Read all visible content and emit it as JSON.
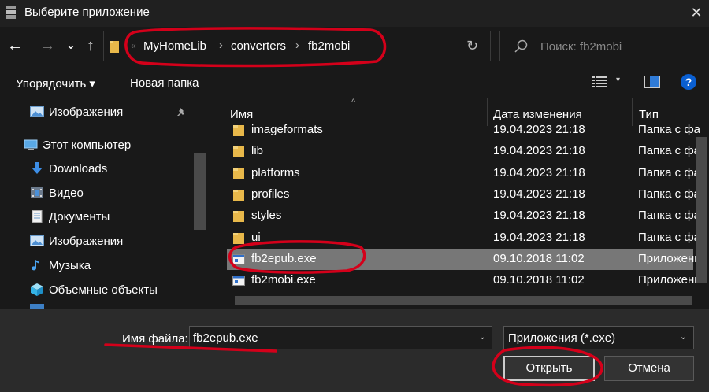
{
  "window": {
    "title": "Выберите приложение",
    "close_glyph": "✕"
  },
  "nav": {
    "back_glyph": "←",
    "forward_glyph": "→",
    "recent_glyph": "⌄",
    "up_glyph": "↑",
    "sep_glyph": "«",
    "breadcrumbs": [
      "MyHomeLib",
      "converters",
      "fb2mobi"
    ],
    "crumb_sep": "›",
    "refresh_glyph": "↻",
    "search_placeholder": "Поиск: fb2mobi"
  },
  "toolbar": {
    "organize_label": "Упорядочить ▾",
    "new_folder_label": "Новая папка",
    "views_dd_glyph": "▾",
    "help_glyph": "?"
  },
  "sidebar": {
    "items": [
      {
        "label": "Изображения",
        "icon": "pictures-icon"
      },
      {
        "label": "Этот компьютер",
        "icon": "computer-icon"
      },
      {
        "label": "Downloads",
        "icon": "downloads-icon"
      },
      {
        "label": "Видео",
        "icon": "video-icon"
      },
      {
        "label": "Документы",
        "icon": "documents-icon"
      },
      {
        "label": "Изображения",
        "icon": "pictures-icon"
      },
      {
        "label": "Музыка",
        "icon": "music-icon"
      },
      {
        "label": "Объемные объекты",
        "icon": "3d-objects-icon"
      }
    ]
  },
  "file_list": {
    "columns": {
      "name": "Имя",
      "date": "Дата изменения",
      "type": "Тип"
    },
    "sort_glyph": "^",
    "rows": [
      {
        "name": "imageformats",
        "date": "19.04.2023 21:18",
        "type": "Папка с фа",
        "kind": "folder"
      },
      {
        "name": "lib",
        "date": "19.04.2023 21:18",
        "type": "Папка с фа",
        "kind": "folder"
      },
      {
        "name": "platforms",
        "date": "19.04.2023 21:18",
        "type": "Папка с фа",
        "kind": "folder"
      },
      {
        "name": "profiles",
        "date": "19.04.2023 21:18",
        "type": "Папка с фа",
        "kind": "folder"
      },
      {
        "name": "styles",
        "date": "19.04.2023 21:18",
        "type": "Папка с фа",
        "kind": "folder"
      },
      {
        "name": "ui",
        "date": "19.04.2023 21:18",
        "type": "Папка с фа",
        "kind": "folder"
      },
      {
        "name": "fb2epub.exe",
        "date": "09.10.2018 11:02",
        "type": "Приложени",
        "kind": "exe",
        "selected": true
      },
      {
        "name": "fb2mobi.exe",
        "date": "09.10.2018 11:02",
        "type": "Приложени",
        "kind": "exe"
      }
    ]
  },
  "footer": {
    "filename_label": "Имя файла:",
    "filename_value": "fb2epub.exe",
    "filter_value": "Приложения (*.exe)",
    "dd_glyph": "⌄",
    "open_label": "Открыть",
    "cancel_label": "Отмена"
  },
  "colors": {
    "background": "#191919",
    "footer": "#2b2b2b",
    "selection": "#777777",
    "folder": "#e8b84a",
    "annotation": "#d4001a"
  }
}
